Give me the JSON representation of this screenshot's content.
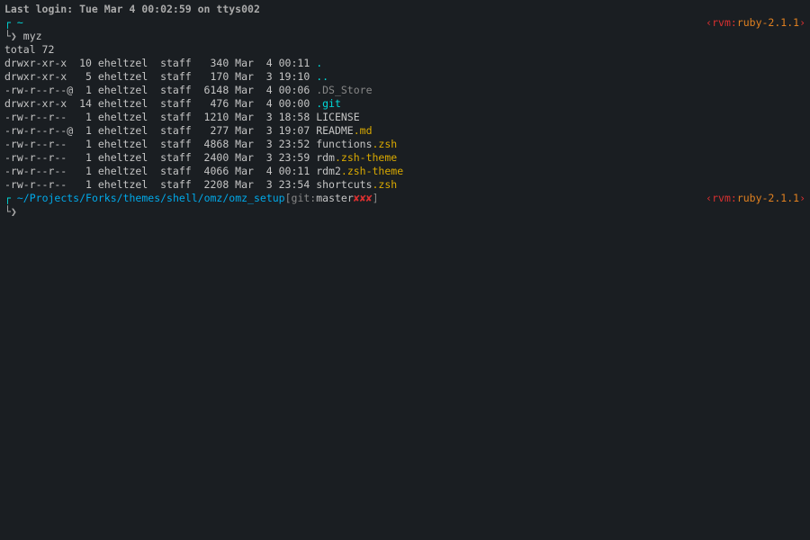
{
  "login_line": "Last login: Tue Mar  4 00:02:59 on ttys002",
  "prompt1": {
    "arrow": "┌",
    "tilde": "~",
    "cmd_arrow": "└❯",
    "command": "myz"
  },
  "rvm": {
    "open": "‹",
    "label": "rvm:",
    "version": "ruby-2.1.1",
    "close": "›"
  },
  "listing": {
    "total": "total 72",
    "rows": [
      {
        "perm": "drwxr-xr-x  10 eheltzel  staff   340 Mar  4 00:11 ",
        "name": ".",
        "class": "dir-color"
      },
      {
        "perm": "drwxr-xr-x   5 eheltzel  staff   170 Mar  3 19:10 ",
        "name": "..",
        "class": "dir-color"
      },
      {
        "perm": "-rw-r--r--@  1 eheltzel  staff  6148 Mar  4 00:06 ",
        "name": ".DS_Store",
        "class": "dotfile-color"
      },
      {
        "perm": "drwxr-xr-x  14 eheltzel  staff   476 Mar  4 00:00 ",
        "name": ".git",
        "class": "dir-color"
      },
      {
        "perm": "-rw-r--r--   1 eheltzel  staff  1210 Mar  3 18:58 ",
        "name": "LICENSE",
        "class": ""
      },
      {
        "perm": "-rw-r--r--@  1 eheltzel  staff   277 Mar  3 19:07 ",
        "name": "README",
        "ext": ".md"
      },
      {
        "perm": "-rw-r--r--   1 eheltzel  staff  4868 Mar  3 23:52 ",
        "name": "functions",
        "ext": ".zsh"
      },
      {
        "perm": "-rw-r--r--   1 eheltzel  staff  2400 Mar  3 23:59 ",
        "name": "rdm",
        "ext": ".zsh-theme"
      },
      {
        "perm": "-rw-r--r--   1 eheltzel  staff  4066 Mar  4 00:11 ",
        "name": "rdm2",
        "ext": ".zsh-theme"
      },
      {
        "perm": "-rw-r--r--   1 eheltzel  staff  2208 Mar  3 23:54 ",
        "name": "shortcuts",
        "ext": ".zsh"
      }
    ]
  },
  "prompt2": {
    "arrow": "┌",
    "path": "~/Projects/Forks/themes/shell/omz/omz_setup",
    "git_open": " [",
    "git_label": "git:",
    "git_branch": " master ",
    "git_dirty": "✘✘✘",
    "git_close": " ]",
    "cmd_arrow": "└❯"
  }
}
